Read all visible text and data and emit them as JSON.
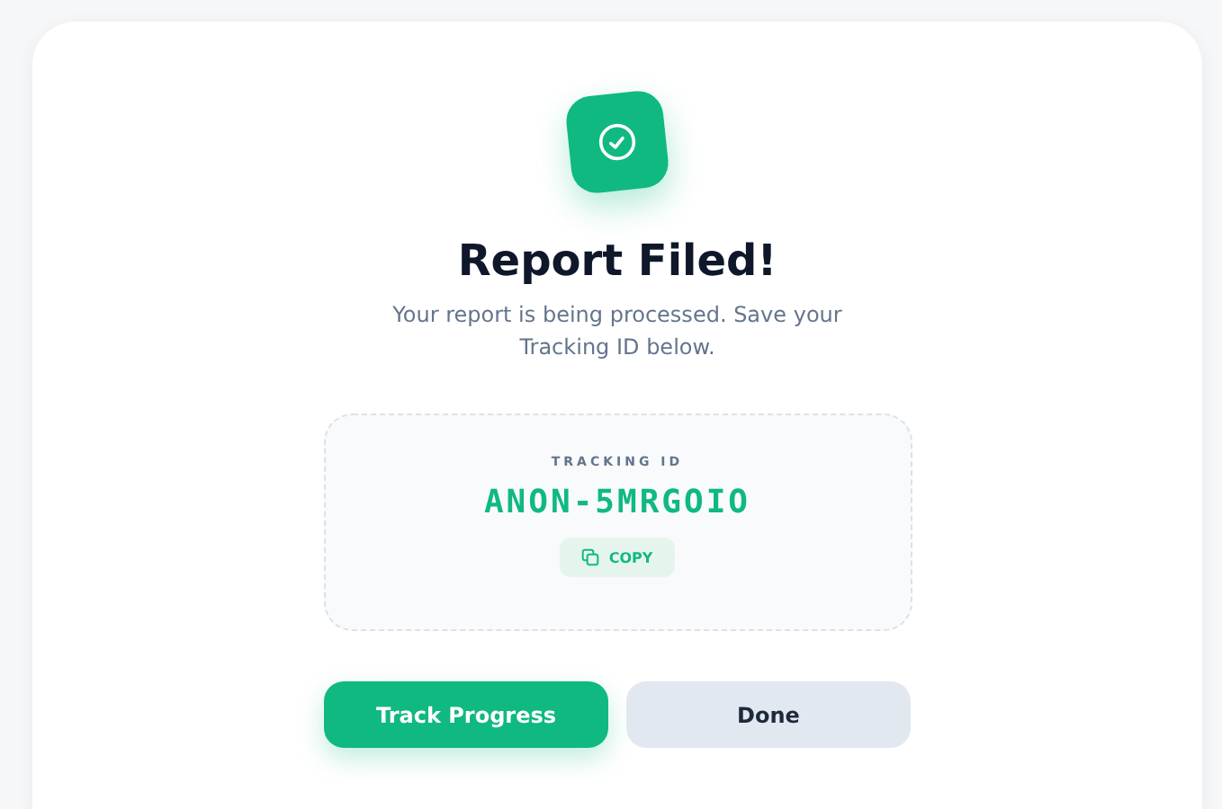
{
  "title": "Report Filed!",
  "message": "Your report is being processed. Save your Tracking ID below.",
  "tracking": {
    "label": "TRACKING ID",
    "id": "ANON-5MRGOIO",
    "copy_button": "COPY"
  },
  "buttons": [
    {
      "label": "Track Progress",
      "kind": "primary"
    },
    {
      "label": "Done",
      "kind": "secondary"
    }
  ]
}
